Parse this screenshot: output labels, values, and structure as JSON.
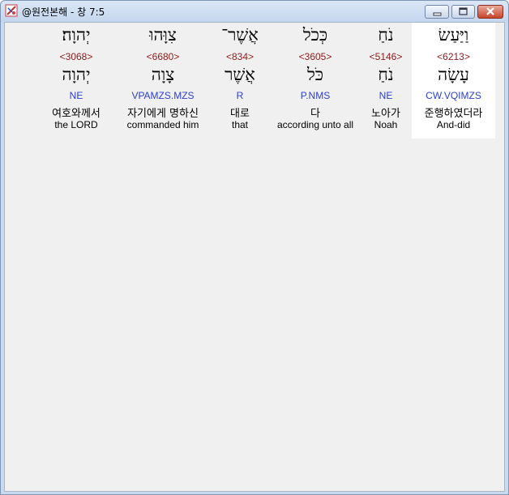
{
  "window": {
    "title": "@원전본해 - 창 7:5"
  },
  "words": [
    {
      "hebrew": "יְהוָה׃",
      "strong": "<3068>",
      "lemma": "יְהוָה",
      "morph": "NE",
      "korean": "여호와께서",
      "english": "the LORD"
    },
    {
      "hebrew": "צִוָּהוּ",
      "strong": "<6680>",
      "lemma": "צָוָה",
      "morph": "VPAMZS.MZS",
      "korean": "자기에게 명하신",
      "english": "commanded him"
    },
    {
      "hebrew": "אֲשֶׁר־",
      "strong": "<834>",
      "lemma": "אֲשֶׁר",
      "morph": "R",
      "korean": "대로",
      "english": "that"
    },
    {
      "hebrew": "כְּכֹל",
      "strong": "<3605>",
      "lemma": "כֹּל",
      "morph": "P.NMS",
      "korean": "다",
      "english": "according unto all"
    },
    {
      "hebrew": "נֹחַ",
      "strong": "<5146>",
      "lemma": "נֹחַ",
      "morph": "NE",
      "korean": "노아가",
      "english": "Noah"
    },
    {
      "hebrew": "וַיַּעַשׂ",
      "strong": "<6213>",
      "lemma": "עָשָׂה",
      "morph": "CW.VQIMZS",
      "korean": "준행하였더라",
      "english": "And-did"
    }
  ]
}
